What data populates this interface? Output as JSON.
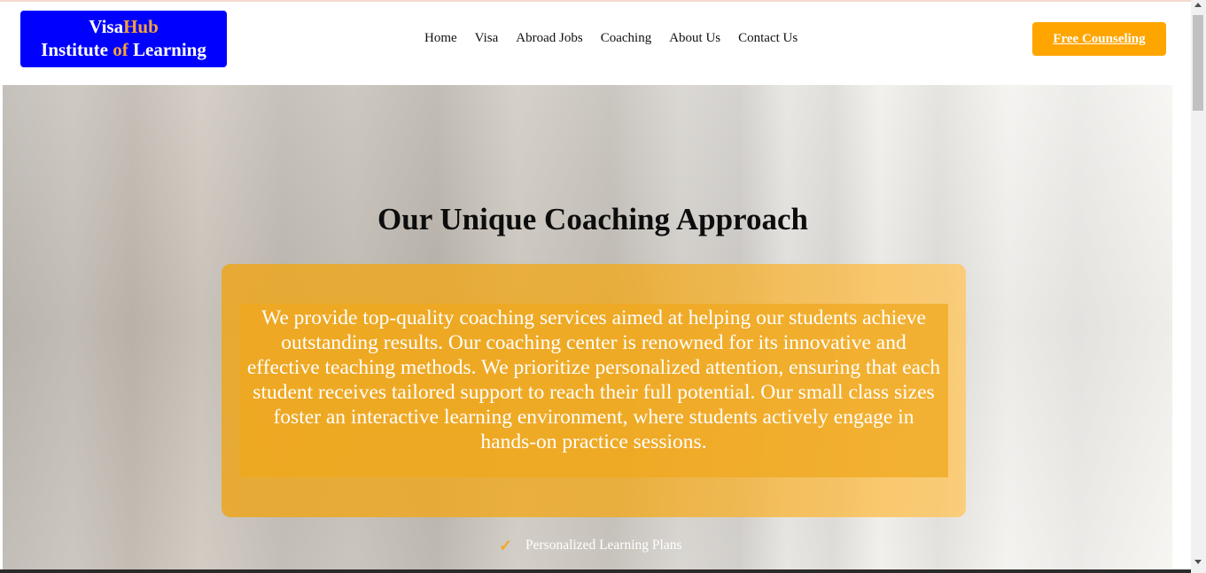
{
  "header": {
    "logo": {
      "line1_a": "Visa",
      "line1_b": "Hub",
      "line2_a": "Institute ",
      "line2_b": "of",
      "line2_c": " Learning"
    },
    "nav": [
      "Home",
      "Visa",
      "Abroad Jobs",
      "Coaching",
      "About Us",
      "Contact Us"
    ],
    "cta_label": "Free Counseling"
  },
  "hero": {
    "title": "Our Unique Coaching Approach",
    "description": "We provide top-quality coaching services aimed at helping our students achieve outstanding results. Our coaching center is renowned for its innovative and effective teaching methods. We prioritize personalized attention, ensuring that each student receives tailored support to reach their full potential. Our small class sizes foster an interactive learning environment, where students actively engage in hands-on practice sessions.",
    "features": [
      "Personalized Learning Plans"
    ]
  },
  "colors": {
    "logo_bg": "#0000ff",
    "accent": "#ffa500",
    "card": "#f0a81e"
  }
}
